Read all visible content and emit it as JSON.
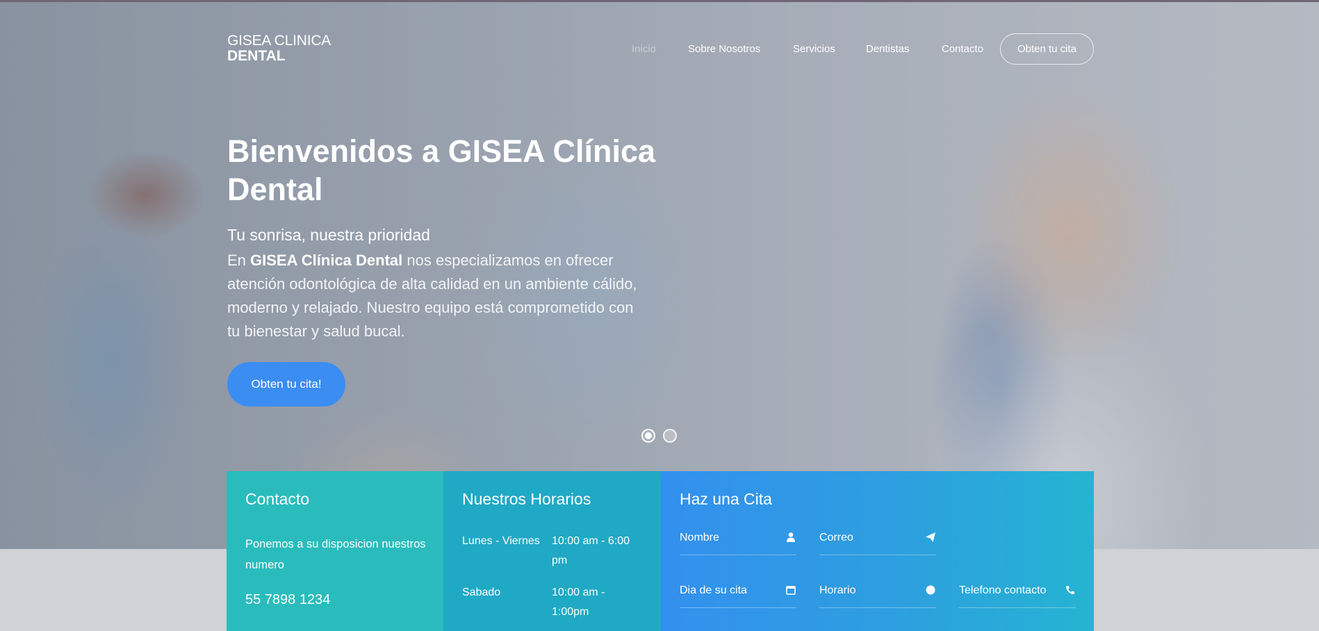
{
  "brand": {
    "line1": "GISEA CLINICA",
    "line2": "DENTAL"
  },
  "nav": {
    "items": [
      {
        "label": "Inicio",
        "active": true
      },
      {
        "label": "Sobre Nosotros",
        "active": false
      },
      {
        "label": "Servicios",
        "active": false
      },
      {
        "label": "Dentistas",
        "active": false
      },
      {
        "label": "Contacto",
        "active": false
      }
    ],
    "cta_label": "Obten tu cita"
  },
  "hero": {
    "headline": "Bienvenidos a GISEA Clínica Dental",
    "subhead": "Tu sonrisa, nuestra prioridad",
    "intro_prefix": "En ",
    "intro_strong": "GISEA Clínica Dental",
    "intro_rest": " nos especializamos en ofrecer atención odontológica de alta calidad en un ambiente cálido, moderno y relajado. Nuestro equipo está comprometido con tu bienestar y salud bucal.",
    "cta_label": "Obten tu cita!",
    "slides": {
      "count": 2,
      "active": 1
    }
  },
  "contact": {
    "title": "Contacto",
    "text": "Ponemos a su disposicion nuestros numero",
    "phone": "55 7898 1234"
  },
  "hours": {
    "title": "Nuestros Horarios",
    "rows": [
      {
        "day": "Lunes - Viernes",
        "time": "10:00 am - 6:00 pm"
      },
      {
        "day": "Sabado",
        "time": "10:00 am - 1:00pm"
      }
    ]
  },
  "appointment": {
    "title": "Haz una Cita",
    "fields": [
      {
        "label": "Nombre",
        "icon": "user-icon"
      },
      {
        "label": "Correo",
        "icon": "paper-plane-icon"
      },
      {
        "label": "Dia de su cita",
        "icon": "calendar-icon"
      },
      {
        "label": "Horario",
        "icon": "clock-icon"
      },
      {
        "label": "Telefono contacto",
        "icon": "phone-icon"
      }
    ]
  },
  "colors": {
    "accent_blue": "#3b8df2",
    "teal": "#2abcbc",
    "cyan": "#20a9c4"
  }
}
